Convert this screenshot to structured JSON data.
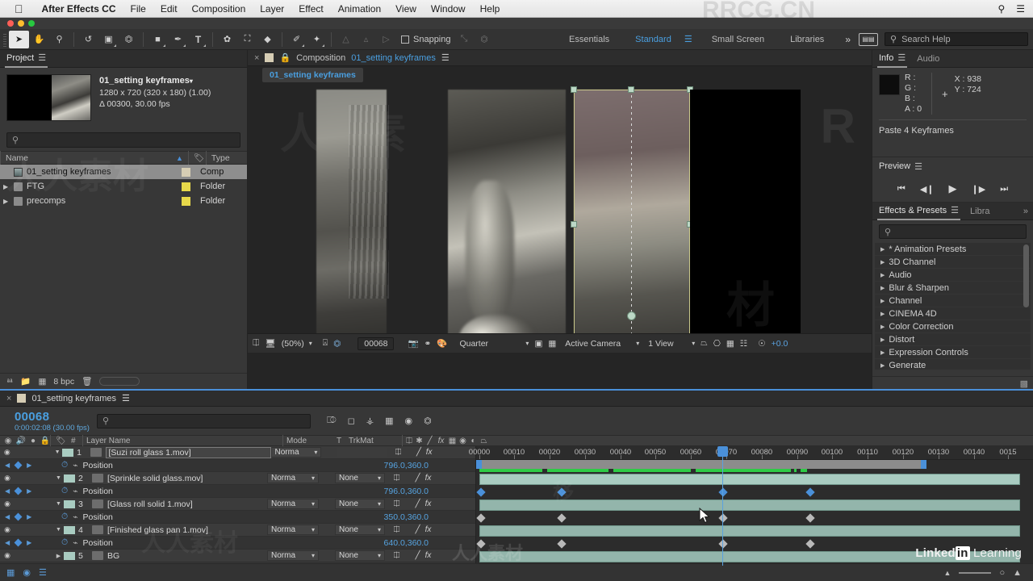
{
  "menubar": {
    "apple_icon": "apple-icon",
    "app_name": "After Effects CC",
    "items": [
      "File",
      "Edit",
      "Composition",
      "Layer",
      "Effect",
      "Animation",
      "View",
      "Window",
      "Help"
    ],
    "right_icons": [
      "search-icon",
      "list-icon"
    ]
  },
  "toolbar": {
    "tools": [
      {
        "name": "selection-tool",
        "glyph": "➤",
        "selected": true
      },
      {
        "name": "hand-tool",
        "glyph": "✋",
        "selected": false
      },
      {
        "name": "zoom-tool",
        "glyph": "🔍",
        "selected": false
      },
      {
        "name": "rotation-tool",
        "glyph": "↺",
        "selected": false
      },
      {
        "name": "camera-tool",
        "glyph": "🎥",
        "selected": false
      },
      {
        "name": "pan-behind-tool",
        "glyph": "⬚",
        "selected": false
      },
      {
        "name": "shape-tool",
        "glyph": "■",
        "selected": false
      },
      {
        "name": "pen-tool",
        "glyph": "✒",
        "selected": false
      },
      {
        "name": "type-tool",
        "glyph": "T",
        "selected": false
      },
      {
        "name": "brush-tool",
        "glyph": "╱",
        "selected": false
      },
      {
        "name": "clone-stamp-tool",
        "glyph": "☗",
        "selected": false
      },
      {
        "name": "eraser-tool",
        "glyph": "◆",
        "selected": false
      },
      {
        "name": "roto-brush-tool",
        "glyph": "✐",
        "selected": false
      },
      {
        "name": "puppet-pin-tool",
        "glyph": "✦",
        "selected": false
      }
    ],
    "dim_tools": [
      {
        "name": "align-left-icon",
        "glyph": "⫧"
      },
      {
        "name": "align-center-icon",
        "glyph": "⩓"
      },
      {
        "name": "align-right-icon",
        "glyph": "⫦"
      }
    ],
    "snapping_label": "Snapping",
    "snapping_checked": false,
    "extra_icons": [
      {
        "name": "snapping-pointer-icon",
        "glyph": "⤡"
      },
      {
        "name": "snapping-box-icon",
        "glyph": "⬚"
      }
    ],
    "workspaces": [
      {
        "label": "Essentials",
        "active": false
      },
      {
        "label": "Standard",
        "active": true
      },
      {
        "label": "Small Screen",
        "active": false
      },
      {
        "label": "Libraries",
        "active": false
      }
    ],
    "overflow_glyph": "»",
    "workspace_menu_icon": "workspace-settings-icon",
    "search_placeholder": "Search Help",
    "search_icon": "search-icon",
    "accent_color": "#4a9fe0"
  },
  "project": {
    "tab_label": "Project",
    "menu_icon": "panel-menu-icon",
    "item": {
      "title": "01_setting keyframes",
      "dimensions": "1280 x 720  (320 x 180) (1.00)",
      "duration": "Δ 00300, 30.00 fps",
      "disclosure_glyph": "▾"
    },
    "search_placeholder": "",
    "search_icon": "search-icon",
    "columns": [
      "Name",
      "Type"
    ],
    "sort_icon": "sort-ascending-icon",
    "tag_icon": "label-tag-icon",
    "rows": [
      {
        "name": "01_setting keyframes",
        "type": "Comp",
        "swatch": "#d6cdb4",
        "selected": true,
        "expandable": false
      },
      {
        "name": "FTG",
        "type": "Folder",
        "swatch": "#e7d84a",
        "selected": false,
        "expandable": true
      },
      {
        "name": "precomps",
        "type": "Folder",
        "swatch": "#e7d84a",
        "selected": false,
        "expandable": true
      }
    ],
    "footer": {
      "bit_depth": "8 bpc",
      "icons": [
        "new-comp-icon",
        "new-folder-icon",
        "comp-settings-icon",
        "delete-icon"
      ]
    }
  },
  "composition": {
    "close_glyph": "×",
    "lock_icon": "lock-icon",
    "panel_label": "Composition",
    "comp_name": "01_setting keyframes",
    "menu_icon": "panel-menu-icon",
    "tab_chip": "01_setting keyframes",
    "footer": {
      "always_preview_icon": "always-preview-icon",
      "main_viewer_icon": "main-viewer-icon",
      "magnification": "(50%)",
      "grid_icon": "choose-grid-icon",
      "mask_icon": "toggle-mask-icon",
      "current_time": "00068",
      "snapshot_icon": "snapshot-icon",
      "show_snapshot_icon": "show-snapshot-icon",
      "channels_icon": "show-channel-icon",
      "resolution": "Quarter",
      "region_icon": "region-of-interest-icon",
      "transparency_icon": "transparency-grid-icon",
      "camera_view": "Active Camera",
      "view_layout": "1 View",
      "pixel_aspect_icon": "pixel-aspect-icon",
      "fast_preview_icon": "fast-preview-icon",
      "timeline_icon": "timeline-icon",
      "flowchart_icon": "comp-flowchart-icon",
      "exposure_icon": "reset-exposure-icon",
      "exposure_value": "+0.0"
    }
  },
  "info_panel": {
    "tabs": [
      {
        "label": "Info",
        "active": true
      },
      {
        "label": "Audio",
        "active": false
      }
    ],
    "menu_icon": "panel-menu-icon",
    "channels": [
      {
        "label": "R :",
        "value": ""
      },
      {
        "label": "G :",
        "value": ""
      },
      {
        "label": "B :",
        "value": ""
      },
      {
        "label": "A :",
        "value": "0"
      }
    ],
    "coords": [
      {
        "label": "X :",
        "value": "938"
      },
      {
        "label": "Y :",
        "value": "724"
      }
    ],
    "crosshair_icon": "crosshair-icon",
    "status_message": "Paste 4 Keyframes"
  },
  "preview_panel": {
    "tab_label": "Preview",
    "menu_icon": "panel-menu-icon",
    "controls": [
      {
        "name": "first-frame-button",
        "glyph": "⏮"
      },
      {
        "name": "previous-frame-button",
        "glyph": "◀❘"
      },
      {
        "name": "play-button",
        "glyph": "▶"
      },
      {
        "name": "next-frame-button",
        "glyph": "❘▶"
      },
      {
        "name": "last-frame-button",
        "glyph": "⏭"
      }
    ]
  },
  "effects_panel": {
    "tabs": [
      {
        "label": "Effects & Presets",
        "active": true
      },
      {
        "label": "Libra",
        "active": false
      }
    ],
    "menu_icon": "panel-menu-icon",
    "overflow_glyph": "»",
    "search_placeholder": "",
    "search_icon": "search-icon",
    "categories": [
      "* Animation Presets",
      "3D Channel",
      "Audio",
      "Blur & Sharpen",
      "Channel",
      "CINEMA 4D",
      "Color Correction",
      "Distort",
      "Expression Controls",
      "Generate"
    ],
    "disclosure_glyph": "▶"
  },
  "timeline": {
    "close_glyph": "×",
    "comp_name": "01_setting keyframes",
    "menu_icon": "panel-menu-icon",
    "current_frame": "00068",
    "current_timecode": "0:00:02:08 (30.00 fps)",
    "search_placeholder": "",
    "search_icon": "search-icon",
    "toolbar_icons": [
      "composition-mini-flowchart-icon",
      "draft-3d-icon",
      "hide-shy-layers-icon",
      "frame-blending-icon",
      "motion-blur-icon",
      "graph-editor-icon"
    ],
    "columns": {
      "av_icons": [
        "video-icon",
        "audio-icon",
        "solo-icon",
        "lock-icon"
      ],
      "label_icon": "label-tag-icon",
      "number": "#",
      "layer_name": "Layer Name",
      "mode": "Mode",
      "t": "T",
      "trkmat": "TrkMat",
      "switches": [
        "shy-icon",
        "collapse-icon",
        "quality-icon",
        "fx-icon",
        "frame-blend-icon",
        "motion-blur-icon",
        "adjustment-icon",
        "3d-icon"
      ]
    },
    "layers": [
      {
        "index": "1",
        "name": "[Suzi roll glass 1.mov]",
        "mode": "Norma",
        "trkmat": "",
        "selected": true,
        "property": {
          "name": "Position",
          "value": "796.0,360.0"
        }
      },
      {
        "index": "2",
        "name": "[Sprinkle solid glass.mov]",
        "mode": "Norma",
        "trkmat": "None",
        "selected": false,
        "property": {
          "name": "Position",
          "value": "796.0,360.0"
        }
      },
      {
        "index": "3",
        "name": "[Glass roll solid 1.mov]",
        "mode": "Norma",
        "trkmat": "None",
        "selected": false,
        "property": {
          "name": "Position",
          "value": "350.0,360.0"
        }
      },
      {
        "index": "4",
        "name": "[Finished glass pan 1.mov]",
        "mode": "Norma",
        "trkmat": "None",
        "selected": false,
        "property": {
          "name": "Position",
          "value": "640.0,360.0"
        }
      },
      {
        "index": "5",
        "name": "BG",
        "mode": "Norma",
        "trkmat": "None",
        "selected": false,
        "property": null
      }
    ],
    "ruler_labels": [
      "00000",
      "00010",
      "00020",
      "00030",
      "00040",
      "00050",
      "00060",
      "00070",
      "00080",
      "00090",
      "00100",
      "00110",
      "00120",
      "00130",
      "00140",
      "0015"
    ],
    "keyframe_frames": [
      0,
      22,
      68,
      90
    ],
    "work_area_end_frame": 125,
    "footer": {
      "icons": [
        "toggle-switches-modes-icon",
        "graph-editor-icon",
        "motion-blur-toggle-icon"
      ],
      "zoom_out_icon": "zoom-out-icon",
      "zoom_slider_icon": "zoom-slider-icon",
      "zoom_in_icon": "zoom-in-icon"
    },
    "branding": {
      "main": "Linked",
      "badge": "in",
      "sub": "Learning"
    }
  },
  "colors": {
    "accent_blue": "#4a9fe0",
    "keyframe_blue": "#4a90d9",
    "layer_bar": "#a9ccc1",
    "green_cache": "#2ecb46",
    "panel_bg": "#373737"
  }
}
